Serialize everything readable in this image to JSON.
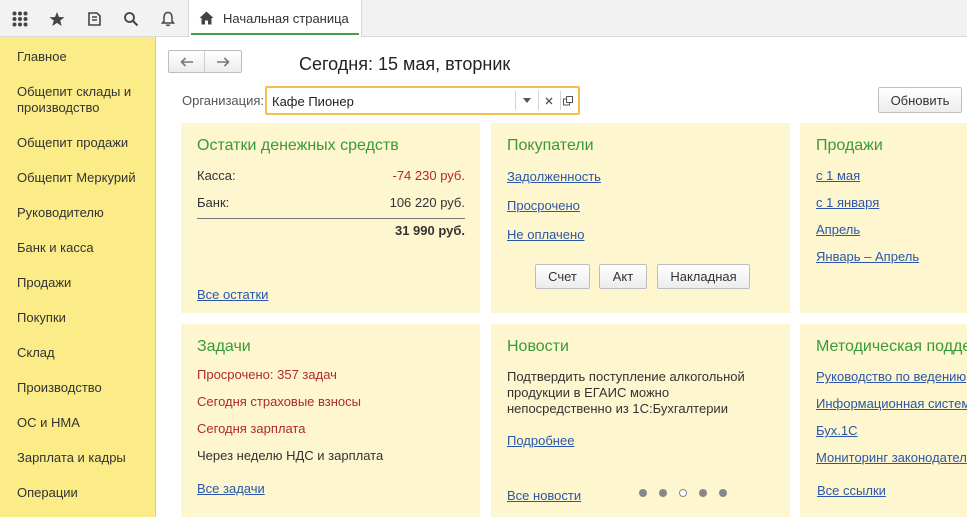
{
  "topbar": {
    "icons": [
      "apps-grid-icon",
      "star-icon",
      "history-icon",
      "search-icon",
      "bell-icon"
    ],
    "tab_label": "Начальная страница"
  },
  "sidebar": {
    "items": [
      {
        "label": "Главное"
      },
      {
        "label": "Общепит склады и производство"
      },
      {
        "label": "Общепит продажи"
      },
      {
        "label": "Общепит Меркурий"
      },
      {
        "label": "Руководителю"
      },
      {
        "label": "Банк и касса"
      },
      {
        "label": "Продажи"
      },
      {
        "label": "Покупки"
      },
      {
        "label": "Склад"
      },
      {
        "label": "Производство"
      },
      {
        "label": "ОС и НМА"
      },
      {
        "label": "Зарплата и кадры"
      },
      {
        "label": "Операции"
      }
    ]
  },
  "header": {
    "today": "Сегодня: 15 мая, вторник",
    "org_label": "Организация:",
    "org_value": "Кафе Пионер",
    "refresh_label": "Обновить"
  },
  "cash": {
    "title": "Остатки денежных средств",
    "kassa_label": "Касса:",
    "kassa_value": "-74 230 руб.",
    "bank_label": "Банк:",
    "bank_value": "106 220 руб.",
    "total_value": "31 990 руб.",
    "link": "Все остатки"
  },
  "buyers": {
    "title": "Покупатели",
    "links": [
      "Задолженность",
      "Просрочено",
      "Не оплачено"
    ],
    "buttons": [
      "Счет",
      "Акт",
      "Накладная"
    ]
  },
  "sales": {
    "title": "Продажи",
    "links": [
      "с 1 мая",
      "с 1 января",
      "Апрель",
      "Январь – Апрель"
    ]
  },
  "tasks": {
    "title": "Задачи",
    "overdue": "Просрочено: 357 задач",
    "insurance": "Сегодня страховые взносы",
    "salary": "Сегодня зарплата",
    "next_week": "Через неделю НДС и зарплата",
    "link": "Все задачи"
  },
  "news": {
    "title": "Новости",
    "lines": [
      "Подтвердить поступление алкогольной",
      "продукции в ЕГАИС можно",
      "непосредственно из 1С:Бухгалтерии"
    ],
    "more": "Подробнее",
    "all": "Все новости",
    "pager_active": 3,
    "pager_total": 5
  },
  "method": {
    "title": "Методическая подде",
    "links": [
      "Руководство по ведению",
      "Информационная систем",
      "Бух.1С",
      "Мониторинг законодател"
    ],
    "all": "Все ссылки"
  },
  "colors": {
    "sidebar_bg": "#fbec88",
    "panel_bg": "#fdf6cf",
    "title_green": "#3a9a3a",
    "link_blue": "#2a57a8",
    "negative_red": "#b02a2a",
    "focus_yellow": "#f0c04a"
  }
}
